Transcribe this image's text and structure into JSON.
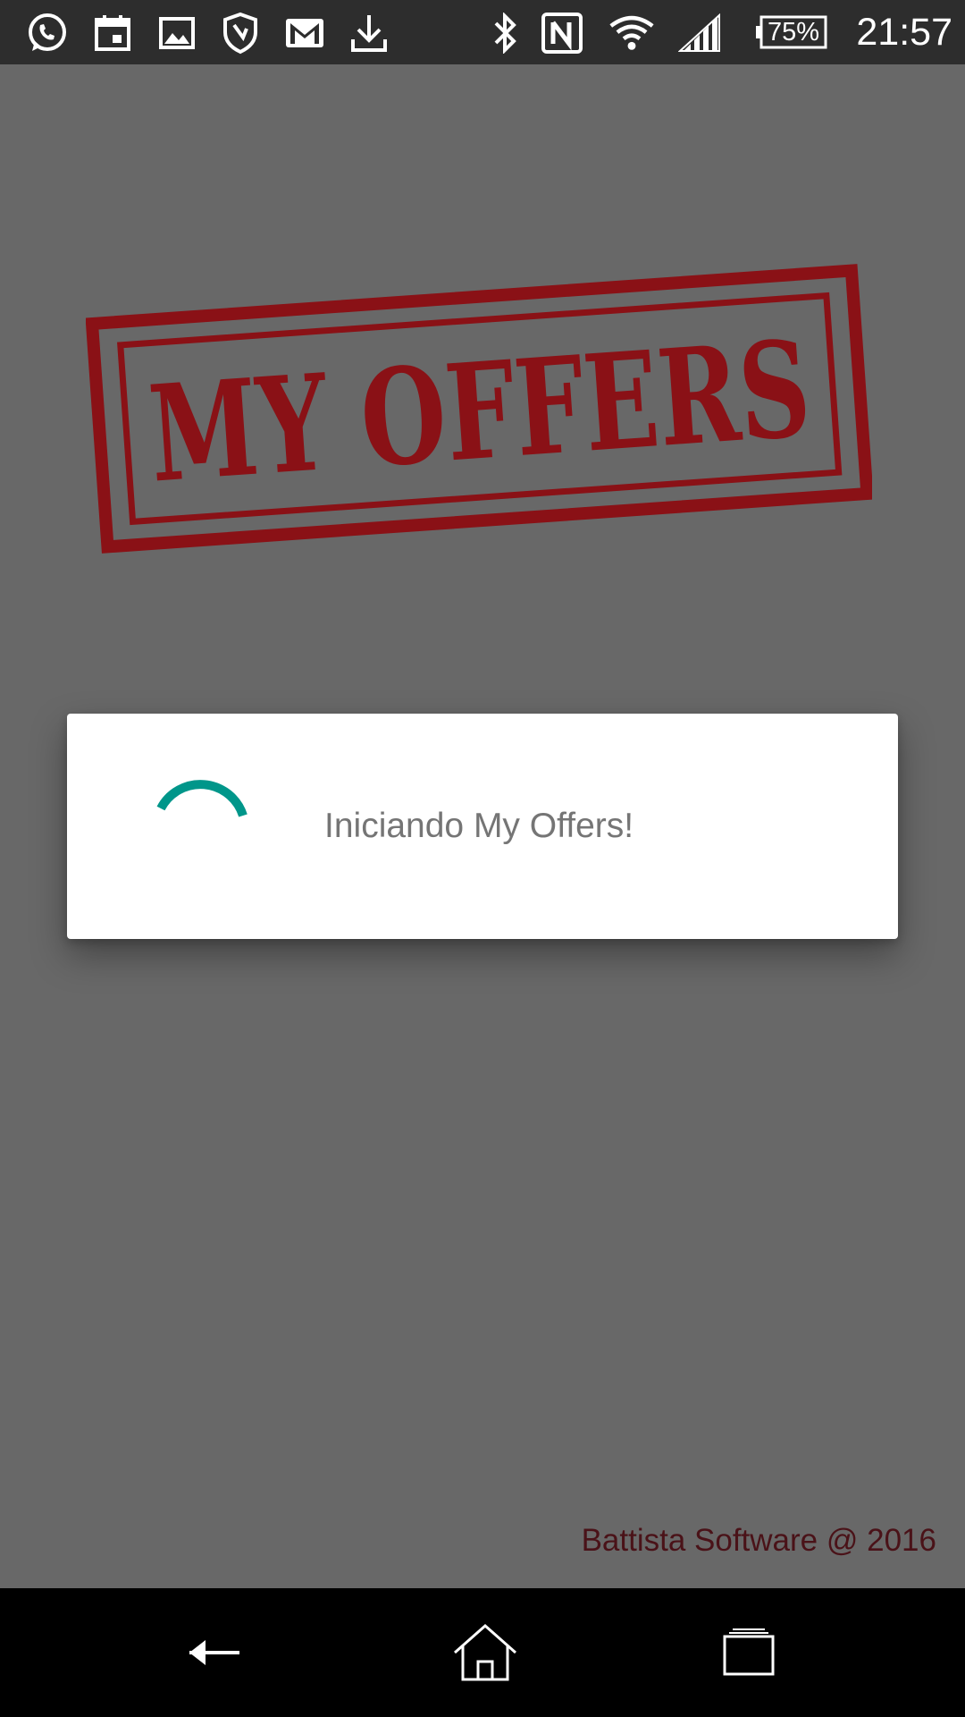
{
  "status_bar": {
    "battery_level": "75%",
    "time": "21:57",
    "icons": [
      "whatsapp-icon",
      "calendar-icon",
      "image-icon",
      "shield-icon",
      "gmail-icon",
      "download-icon",
      "bluetooth-icon",
      "nfc-icon",
      "wifi-icon",
      "signal-icon",
      "battery-icon"
    ]
  },
  "app": {
    "logo_text": "MY OFFERS",
    "logo_color": "#8a1116"
  },
  "dialog": {
    "message": "Iniciando My Offers!",
    "spinner_color": "#00968a"
  },
  "footer": {
    "credit": "Battista Software @ 2016"
  },
  "nav_bar": {
    "buttons": [
      "back-icon",
      "home-icon",
      "recents-icon"
    ]
  }
}
